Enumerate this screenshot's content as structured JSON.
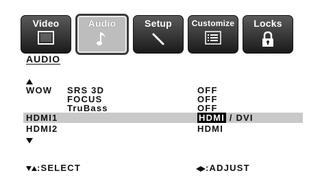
{
  "tabs": [
    {
      "label": "Video",
      "icon": "screen-icon",
      "active": false
    },
    {
      "label": "Audio",
      "icon": "music-note-icon",
      "active": true
    },
    {
      "label": "Setup",
      "icon": "wrench-icon",
      "active": false
    },
    {
      "label": "Customize",
      "icon": "list-icon",
      "active": false
    },
    {
      "label": "Locks",
      "icon": "padlock-icon",
      "active": false
    }
  ],
  "section_title": "AUDIO",
  "settings": [
    {
      "group": "WOW",
      "name": "SRS 3D",
      "value": "OFF"
    },
    {
      "group": "",
      "name": "FOCUS",
      "value": "OFF"
    },
    {
      "group": "",
      "name": "TruBass",
      "value": "OFF"
    },
    {
      "group": "HDMI1",
      "name": "",
      "value": "HDMI",
      "value_suffix": " / DVI",
      "selected": true
    },
    {
      "group": "HDMI2",
      "name": "",
      "value": "HDMI"
    }
  ],
  "footer": {
    "select_hint": ":SELECT",
    "adjust_hint": ":ADJUST"
  },
  "colors": {
    "tab_dark": "#2a2a2a",
    "tab_active": "#bdbdbd",
    "highlight_row": "#c9c9c9",
    "text": "#111111"
  }
}
